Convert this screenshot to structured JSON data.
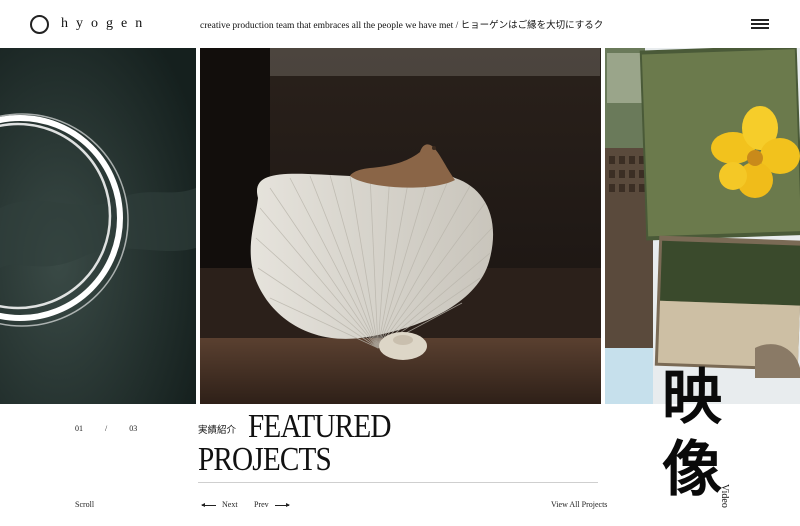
{
  "header": {
    "logo_text": "hyogen",
    "tagline": "creative production team that embraces all the people we have met / ヒョーゲンはご縁を大切にするクリエイティブプロダクショ"
  },
  "slides": {
    "current": "01",
    "separator": "/",
    "total": "03"
  },
  "section": {
    "label_jp": "実績紹介",
    "title_line1": "FEATURED",
    "title_line2": "PROJECTS"
  },
  "footer": {
    "scroll": "Scroll",
    "next": "Next",
    "prev": "Prev",
    "view_all": "View All Projects"
  },
  "category": {
    "kanji_1": "映",
    "kanji_2": "像",
    "label_en": "Video"
  },
  "colors": {
    "background": "#ffffff",
    "text": "#111111",
    "panel_left": "#1f2d2a",
    "panel_mid": "#1a1512"
  },
  "icons": {
    "logo": "ring-icon",
    "menu": "hamburger-menu-icon"
  }
}
